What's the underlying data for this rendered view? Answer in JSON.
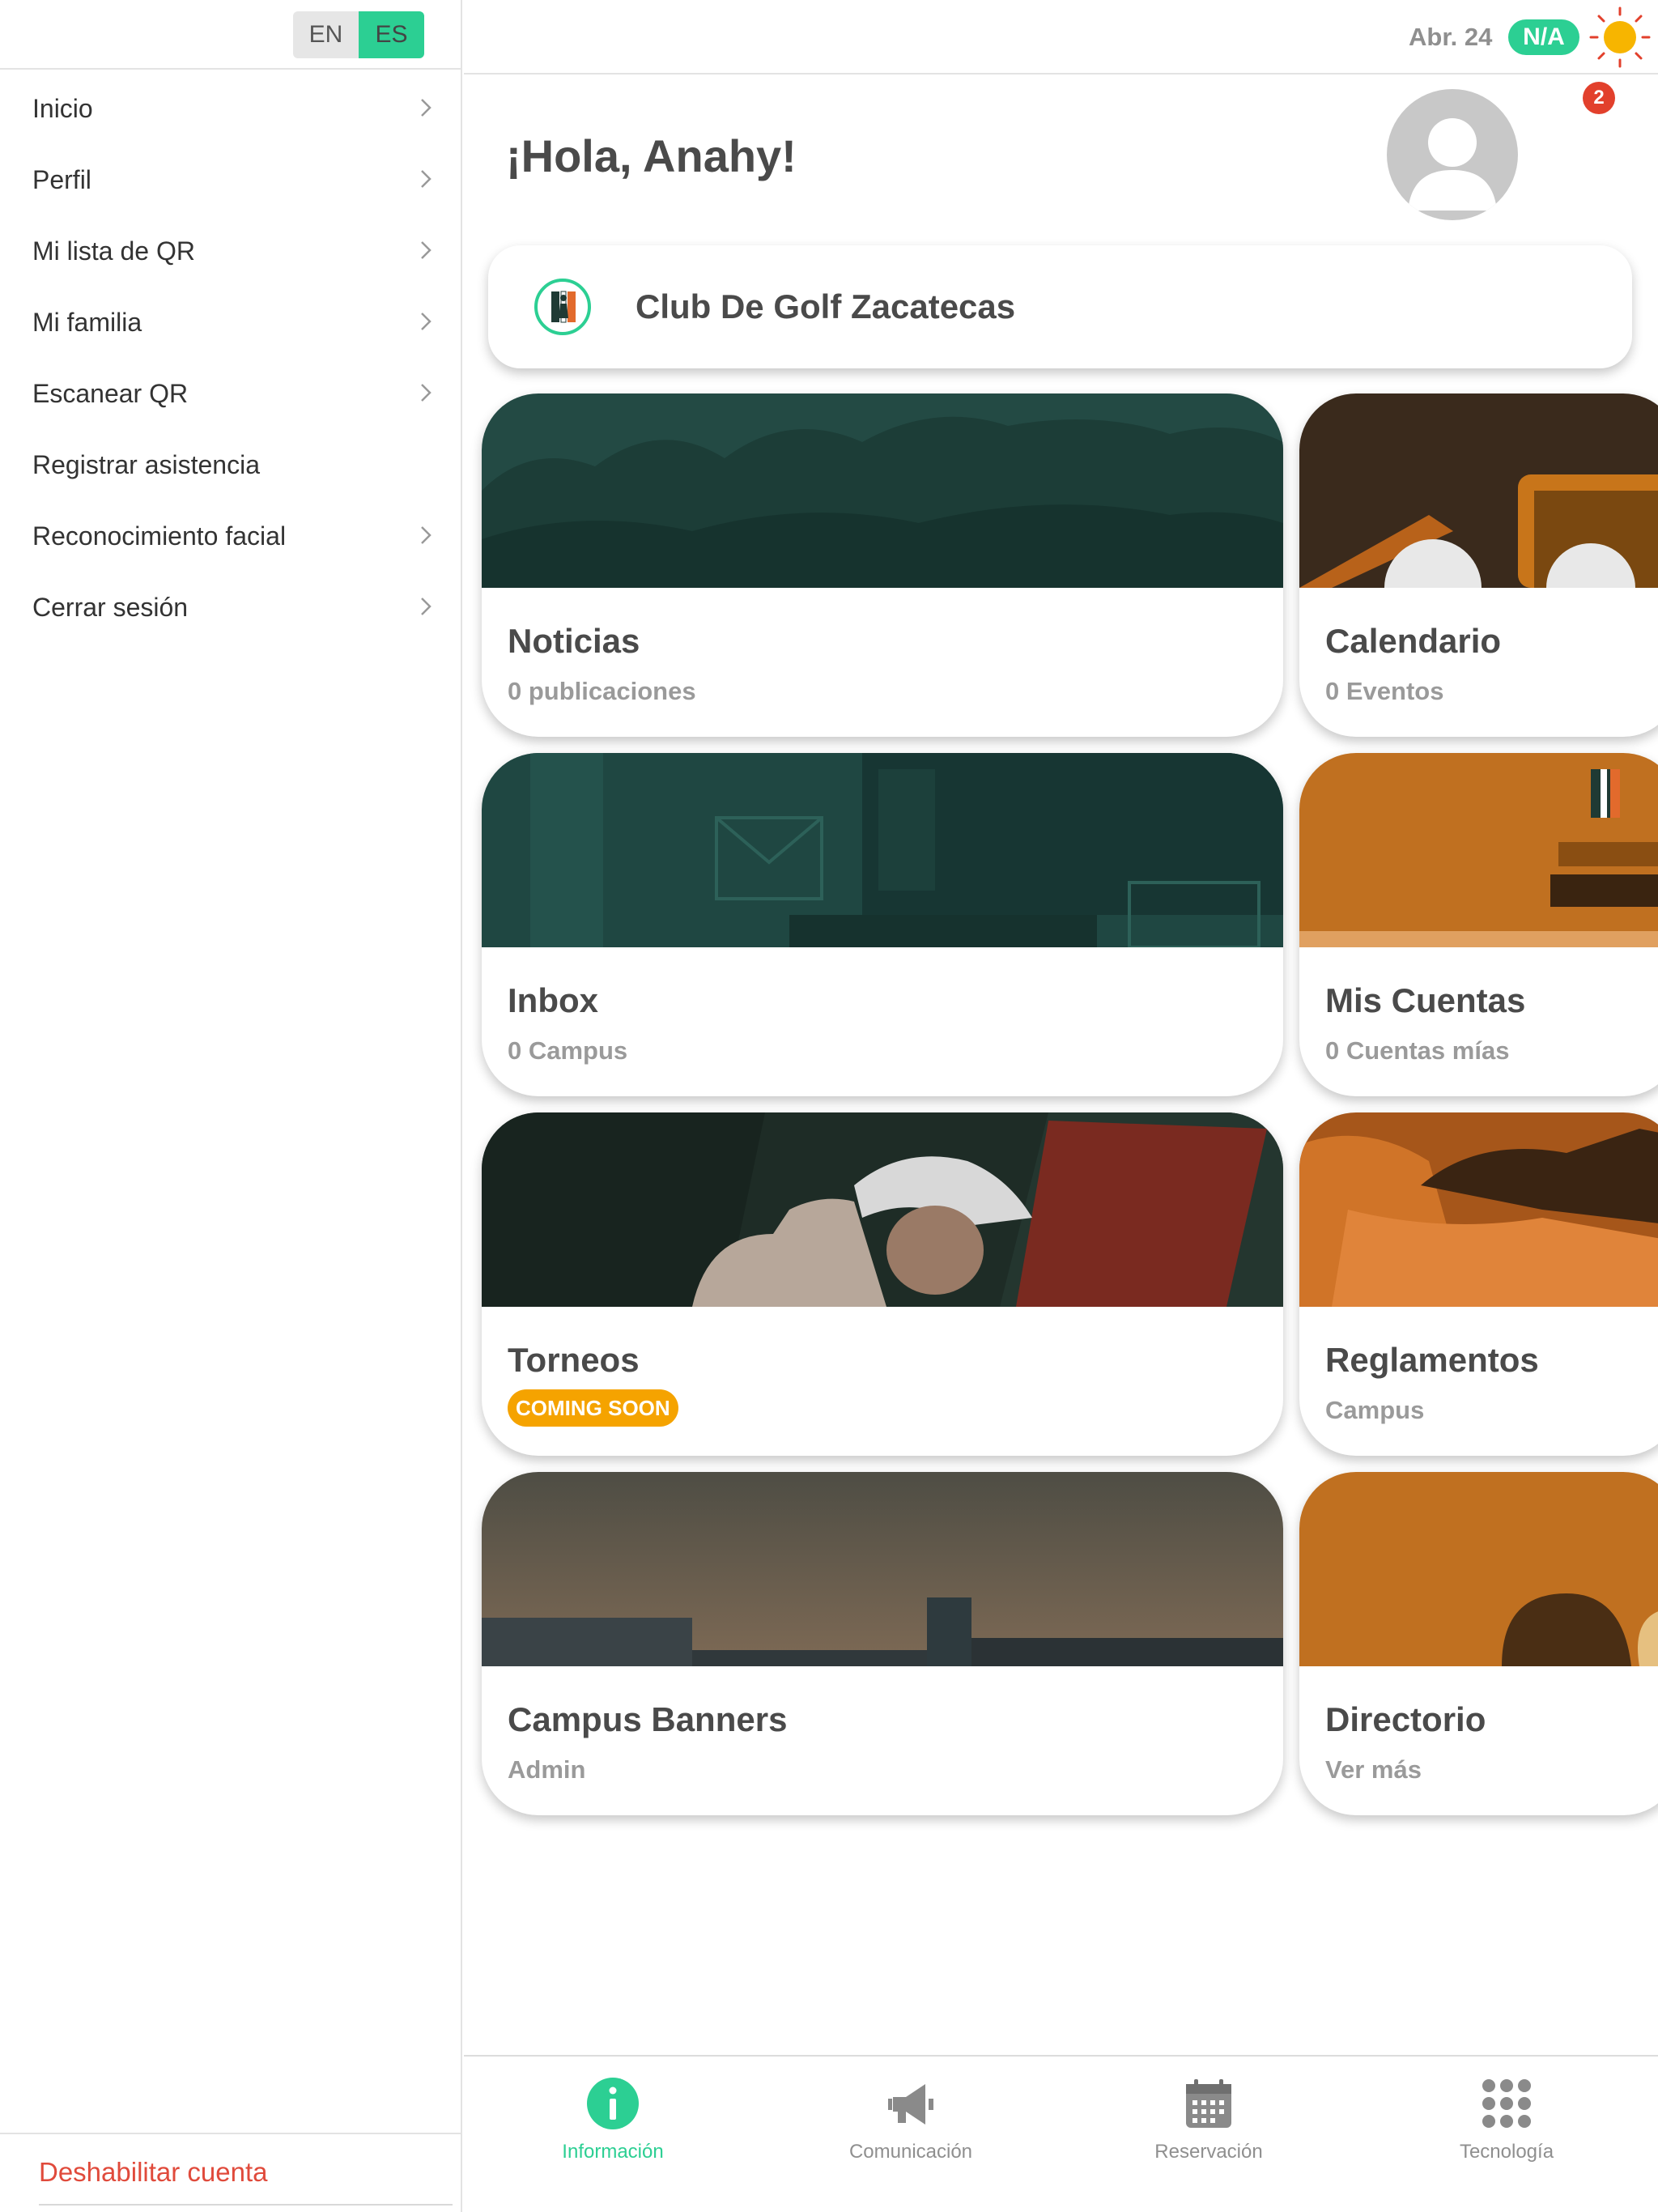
{
  "language_switch": {
    "en": "EN",
    "es": "ES",
    "active": "ES"
  },
  "sidebar": {
    "items": [
      {
        "label": "Inicio",
        "chevron": true
      },
      {
        "label": "Perfil",
        "chevron": true
      },
      {
        "label": "Mi lista de QR",
        "chevron": true
      },
      {
        "label": "Mi familia",
        "chevron": true
      },
      {
        "label": "Escanear QR",
        "chevron": true
      },
      {
        "label": "Registrar asistencia",
        "chevron": false
      },
      {
        "label": "Reconocimiento facial",
        "chevron": true
      },
      {
        "label": "Cerrar sesión",
        "chevron": true
      }
    ],
    "deactivate_label": "Deshabilitar cuenta"
  },
  "topbar": {
    "date": "Abr. 24",
    "weather_badge": "N/A",
    "weather_icon": "sun-icon",
    "notifications_count": "2"
  },
  "greeting": "¡Hola, Anahy!",
  "club": {
    "name": "Club De Golf Zacatecas"
  },
  "cards": [
    {
      "title": "Noticias",
      "subtitle": "0 publicaciones"
    },
    {
      "title": "Calendario",
      "subtitle": "0 Eventos"
    },
    {
      "title": "Inbox",
      "subtitle": "0 Campus"
    },
    {
      "title": "Mis Cuentas",
      "subtitle": "0 Cuentas mías"
    },
    {
      "title": "Torneos",
      "badge": "COMING SOON"
    },
    {
      "title": "Reglamentos",
      "subtitle": "Campus"
    },
    {
      "title": "Campus Banners",
      "subtitle": "Admin"
    },
    {
      "title": "Directorio",
      "subtitle": "Ver más"
    }
  ],
  "bottom_nav": [
    {
      "label": "Información",
      "icon": "info-icon",
      "active": true
    },
    {
      "label": "Comunicación",
      "icon": "megaphone-icon",
      "active": false
    },
    {
      "label": "Reservación",
      "icon": "calendar-icon",
      "active": false
    },
    {
      "label": "Tecnología",
      "icon": "grid-icon",
      "active": false
    }
  ],
  "colors": {
    "accent": "#2ccf93",
    "danger": "#e04a3b",
    "badge": "#f5a300"
  }
}
